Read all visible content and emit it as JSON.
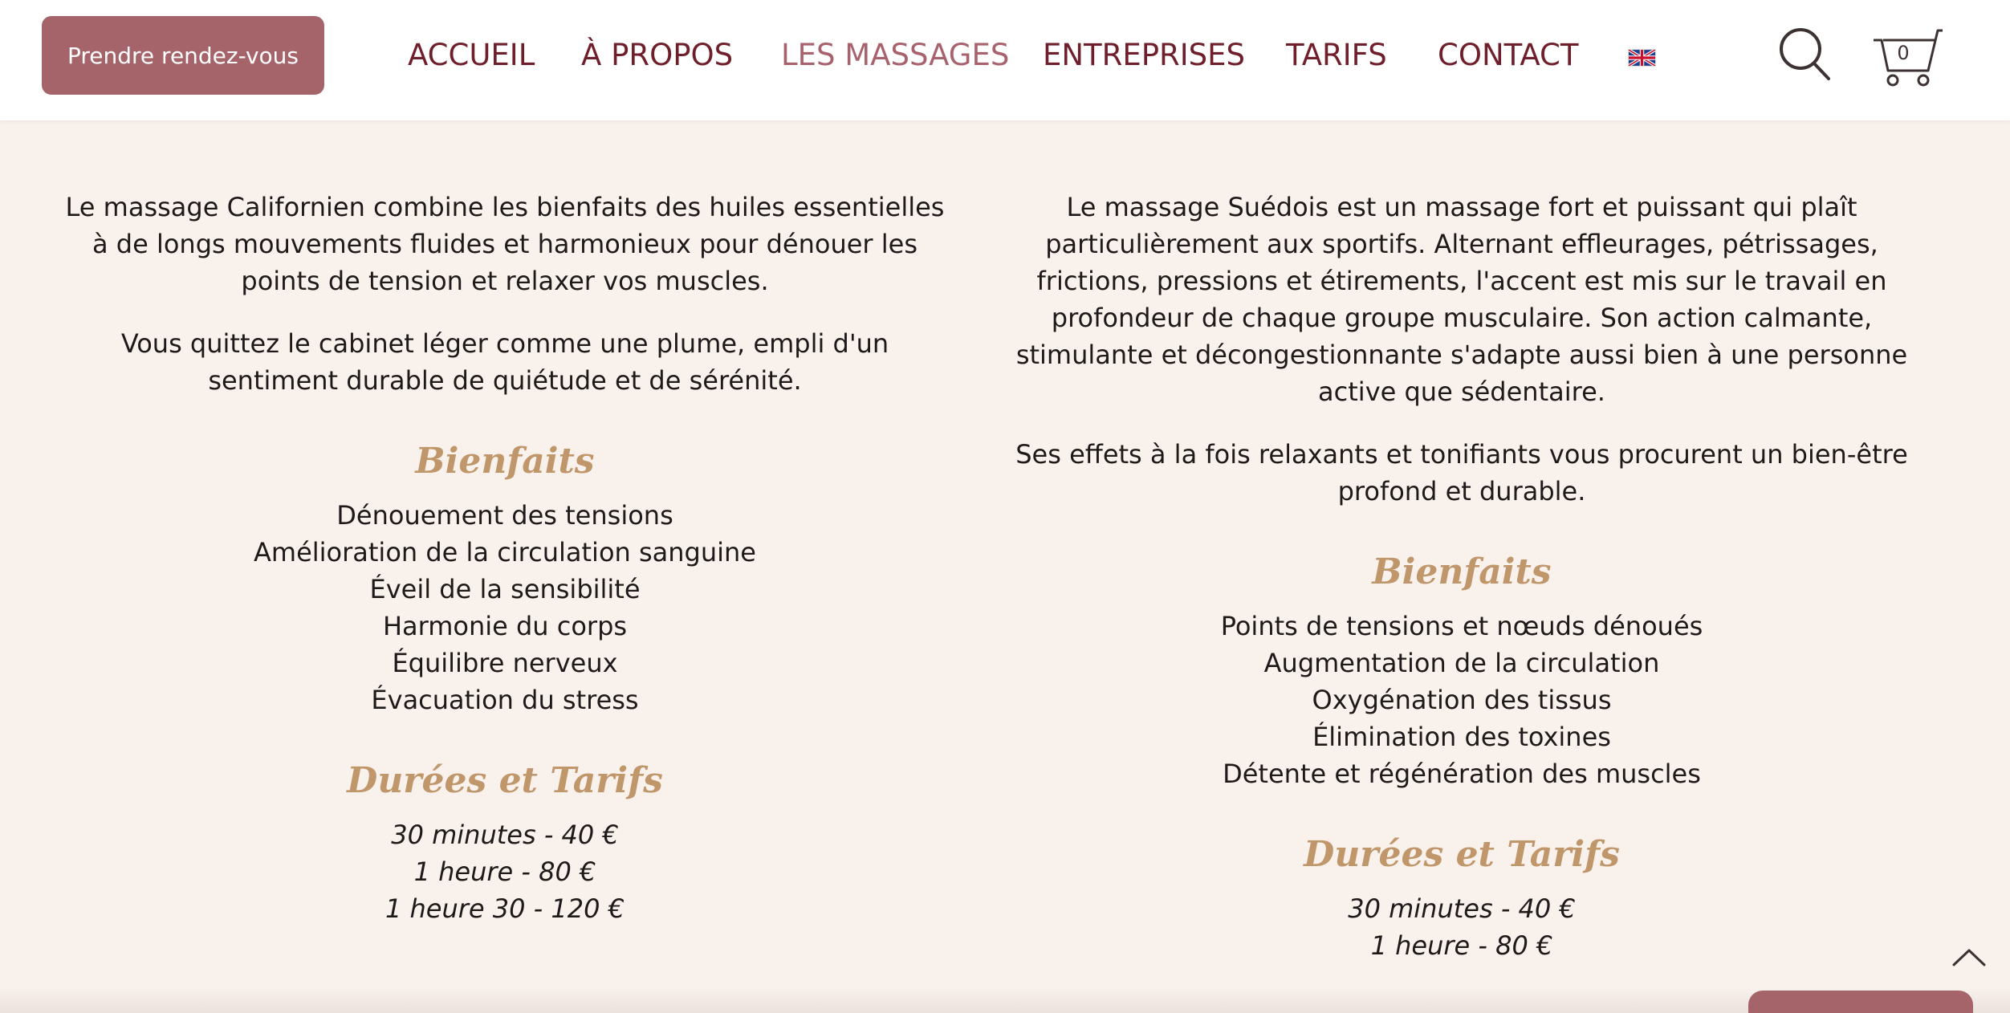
{
  "header": {
    "cta_label": "Prendre rendez-vous",
    "nav": [
      {
        "label": "ACCUEIL",
        "active": false
      },
      {
        "label": "À PROPOS",
        "active": false
      },
      {
        "label": "LES MASSAGES",
        "active": true
      },
      {
        "label": "ENTREPRISES",
        "active": false
      },
      {
        "label": "TARIFS",
        "active": false
      },
      {
        "label": "CONTACT",
        "active": false
      }
    ],
    "language_icon": "uk-flag-icon",
    "search_icon": "search-icon",
    "cart_icon": "cart-icon",
    "cart_count": "0"
  },
  "left": {
    "paragraphs": [
      "Le massage Californien combine les bienfaits des huiles essentielles à de longs mouvements fluides et harmonieux pour dénouer les points de tension et relaxer vos muscles.",
      "Vous quittez le cabinet léger comme une plume, empli d'un sentiment durable de quiétude et de sérénité."
    ],
    "benefits_title": "Bienfaits",
    "benefits": [
      "Dénouement des tensions",
      "Amélioration de la circulation sanguine",
      "Éveil de la sensibilité",
      "Harmonie du corps",
      "Équilibre nerveux",
      "Évacuation du stress"
    ],
    "tarifs_title": "Durées et Tarifs",
    "tarifs": [
      "30 minutes - 40 €",
      "1 heure - 80 €",
      "1 heure 30 - 120 €"
    ]
  },
  "right": {
    "paragraphs": [
      "Le massage Suédois est un massage fort et puissant qui plaît particulièrement aux sportifs. Alternant effleurages, pétrissages, frictions, pressions et étirements, l'accent est mis sur le travail en profondeur de chaque groupe musculaire. Son action calmante, stimulante et décongestionnante s'adapte aussi bien à une personne active que sédentaire.",
      "Ses effets à la fois relaxants et tonifiants vous procurent un bien-être profond et durable."
    ],
    "benefits_title": "Bienfaits",
    "benefits": [
      "Points de tensions et nœuds dénoués",
      "Augmentation de la circulation",
      "Oxygénation des tissus",
      "Élimination des toxines",
      "Détente et régénération des muscles"
    ],
    "tarifs_title": "Durées et Tarifs",
    "tarifs": [
      "30 minutes - 40 €",
      "1 heure - 80 €"
    ]
  },
  "colors": {
    "accent": "#a5636a",
    "nav_text": "#6f1f2c",
    "nav_active": "#a8626d",
    "section_title": "#c0966b",
    "background": "#f9f1ec"
  },
  "controls": {
    "scroll_top_icon": "chevron-up-icon"
  }
}
